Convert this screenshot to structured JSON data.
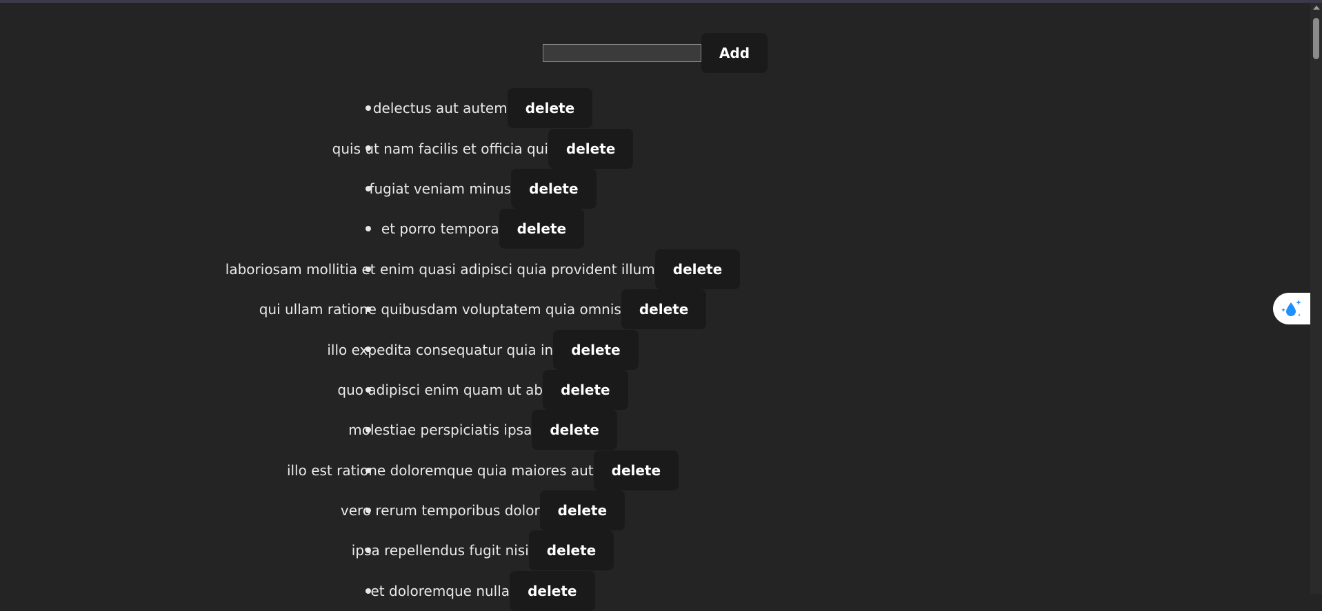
{
  "form": {
    "input_value": "",
    "add_label": "Add"
  },
  "todos": [
    {
      "text": "delectus aut autem",
      "delete_label": "delete"
    },
    {
      "text": "quis ut nam facilis et officia qui",
      "delete_label": "delete"
    },
    {
      "text": "fugiat veniam minus",
      "delete_label": "delete"
    },
    {
      "text": "et porro tempora",
      "delete_label": "delete"
    },
    {
      "text": "laboriosam mollitia et enim quasi adipisci quia provident illum",
      "delete_label": "delete"
    },
    {
      "text": "qui ullam ratione quibusdam voluptatem quia omnis",
      "delete_label": "delete"
    },
    {
      "text": "illo expedita consequatur quia in",
      "delete_label": "delete"
    },
    {
      "text": "quo adipisci enim quam ut ab",
      "delete_label": "delete"
    },
    {
      "text": "molestiae perspiciatis ipsa",
      "delete_label": "delete"
    },
    {
      "text": "illo est ratione doloremque quia maiores aut",
      "delete_label": "delete"
    },
    {
      "text": "vero rerum temporibus dolor",
      "delete_label": "delete"
    },
    {
      "text": "ipsa repellendus fugit nisi",
      "delete_label": "delete"
    },
    {
      "text": "et doloremque nulla",
      "delete_label": "delete"
    }
  ],
  "widget": {
    "icon": "water-drop-sparkle-icon",
    "accent_color": "#1e90ff"
  },
  "colors": {
    "background": "#242424",
    "button_bg": "#1a1a1a",
    "text": "#eaeaea"
  }
}
